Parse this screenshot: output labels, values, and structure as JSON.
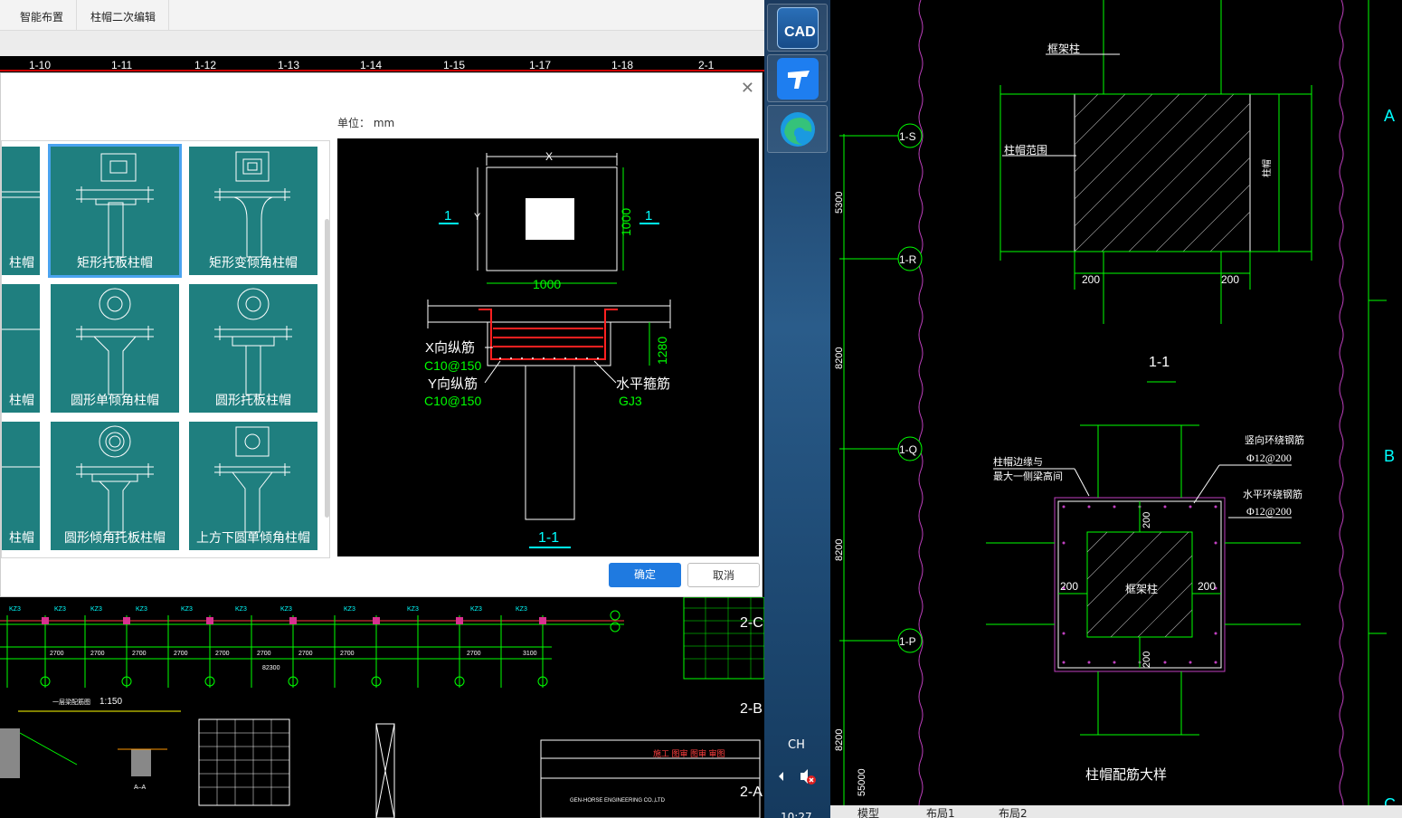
{
  "ribbon": {
    "tabs": [
      "智能布置",
      "柱帽二次编辑"
    ]
  },
  "axis_strip": {
    "ticks": [
      "1-10",
      "1-11",
      "1-12",
      "1-13",
      "1-14",
      "1-15",
      "1-17",
      "1-18",
      "2-1"
    ]
  },
  "dialog": {
    "unit_label": "单位：  mm",
    "ok_label": "确定",
    "cancel_label": "取消",
    "tiles": [
      {
        "label": "柱帽"
      },
      {
        "label": "矩形托板柱帽"
      },
      {
        "label": "矩形变倾角柱帽"
      },
      {
        "label": "柱帽"
      },
      {
        "label": "圆形单倾角柱帽"
      },
      {
        "label": "圆形托板柱帽"
      },
      {
        "label": "柱帽"
      },
      {
        "label": "圆形倾角托板柱帽"
      },
      {
        "label": "上方下圆单倾角柱帽"
      }
    ],
    "preview": {
      "dim_x": "X",
      "dim_y": "Y",
      "plan_w": "1000",
      "plan_h": "1000",
      "section_mark": "1",
      "height": "1280",
      "x_bar": "X向纵筋",
      "x_bar_spec": "C10@150",
      "y_bar": "Y向纵筋",
      "y_bar_spec": "C10@150",
      "stirrup": "水平箍筋",
      "stirrup_spec": "GJ3",
      "section_title": "1-1"
    }
  },
  "taskbar": {
    "ime": "CH",
    "time": "10:27",
    "apps": [
      "cad-app-icon",
      "tencent-app-icon",
      "edge-browser-icon"
    ]
  },
  "bottom_cad": {
    "dims": [
      "2700",
      "2700",
      "2700",
      "2700",
      "2700",
      "2700",
      "2700",
      "2700",
      "2700",
      "3100"
    ],
    "total": "82300",
    "scale_text": "1:150",
    "section_label": "A–A",
    "axis_b": "2-B",
    "axis_a": "2-A",
    "axis_c": "2-C",
    "company": "GEN-HORSE ENGINEERING CO.,LTD"
  },
  "right_cad": {
    "axis_labels": [
      "1-S",
      "1-R",
      "1-Q",
      "1-P"
    ],
    "dims_vertical": [
      "5300",
      "8200",
      "8200",
      "8200",
      "55000"
    ],
    "grid_right": [
      "A",
      "B",
      "C"
    ],
    "top_detail": {
      "label_col": "框架柱",
      "label_range": "柱帽范围",
      "dim_l": "200",
      "dim_r": "200",
      "title": "1-1",
      "side_label": "柱帽"
    },
    "bottom_detail": {
      "label_gap": "柱帽边缘与\n最大一侧梁高间",
      "vert_ring": "竖向环绕钢筋",
      "vert_ring_spec": "Φ12@200",
      "horiz_ring": "水平环绕钢筋",
      "horiz_ring_spec": "Φ12@200",
      "col": "框架柱",
      "d_top": "200",
      "d_left": "200",
      "d_right": "200",
      "d_bottom": "200",
      "title": "柱帽配筋大样"
    },
    "tabs": [
      "模型",
      "布局1",
      "布局2"
    ]
  }
}
